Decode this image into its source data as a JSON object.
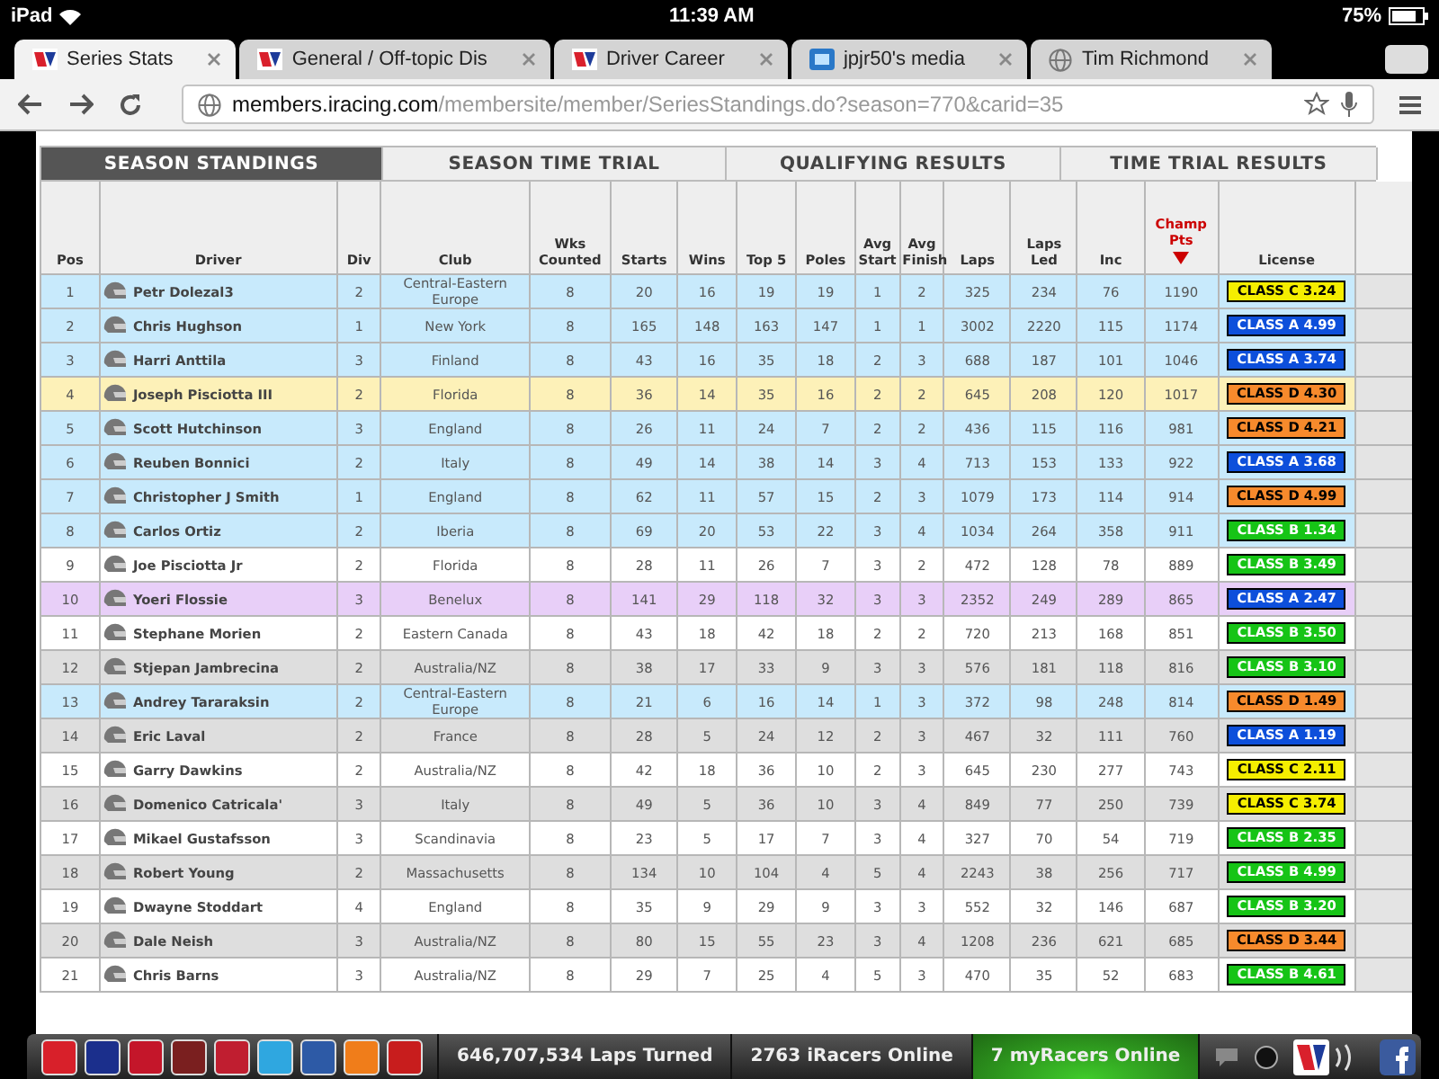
{
  "status_bar": {
    "device": "iPad",
    "time": "11:39 AM",
    "battery": "75%"
  },
  "browser_tabs": [
    {
      "title": "Series Stats",
      "selected": true
    },
    {
      "title": "General / Off-topic Dis",
      "selected": false
    },
    {
      "title": "Driver Career",
      "selected": false
    },
    {
      "title": "jpjr50's media",
      "selected": false
    },
    {
      "title": "Tim Richmond",
      "selected": false
    }
  ],
  "address_bar": {
    "host": "members.iracing.com",
    "path": "/membersite/member/SeriesStandings.do?season=770&carid=35"
  },
  "standings_tabs": [
    {
      "label": "SEASON STANDINGS",
      "selected": true
    },
    {
      "label": "SEASON TIME TRIAL",
      "selected": false
    },
    {
      "label": "QUALIFYING RESULTS",
      "selected": false
    },
    {
      "label": "TIME TRIAL RESULTS",
      "selected": false
    }
  ],
  "table": {
    "columns": [
      {
        "label": "Pos",
        "sorted": false
      },
      {
        "label": "Driver",
        "sorted": false
      },
      {
        "label": "Div",
        "sorted": false
      },
      {
        "label": "Club",
        "sorted": false
      },
      {
        "label": "Wks Counted",
        "sorted": false
      },
      {
        "label": "Starts",
        "sorted": false
      },
      {
        "label": "Wins",
        "sorted": false
      },
      {
        "label": "Top 5",
        "sorted": false
      },
      {
        "label": "Poles",
        "sorted": false
      },
      {
        "label": "Avg Start",
        "sorted": false
      },
      {
        "label": "Avg Finish",
        "sorted": false
      },
      {
        "label": "Laps",
        "sorted": false
      },
      {
        "label": "Laps Led",
        "sorted": false
      },
      {
        "label": "Inc",
        "sorted": false
      },
      {
        "label": "Champ Pts",
        "sorted": true
      },
      {
        "label": "License",
        "sorted": false
      }
    ],
    "rows": [
      {
        "cells": [
          "1",
          "Petr Dolezal3",
          "2",
          "Central-Eastern Europe",
          "8",
          "20",
          "16",
          "19",
          "19",
          "1",
          "2",
          "325",
          "234",
          "76",
          "1190"
        ],
        "license": {
          "text": "CLASS C 3.24",
          "color": "#f5ee00"
        },
        "color": "#c8eafc"
      },
      {
        "cells": [
          "2",
          "Chris Hughson",
          "1",
          "New York",
          "8",
          "165",
          "148",
          "163",
          "147",
          "1",
          "1",
          "3002",
          "2220",
          "115",
          "1174"
        ],
        "license": {
          "text": "CLASS A 4.99",
          "color": "#0d4fdb"
        },
        "color": "#c8eafc"
      },
      {
        "cells": [
          "3",
          "Harri Anttila",
          "3",
          "Finland",
          "8",
          "43",
          "16",
          "35",
          "18",
          "2",
          "3",
          "688",
          "187",
          "101",
          "1046"
        ],
        "license": {
          "text": "CLASS A 3.74",
          "color": "#0d4fdb"
        },
        "color": "#c8eafc"
      },
      {
        "cells": [
          "4",
          "Joseph Pisciotta III",
          "2",
          "Florida",
          "8",
          "36",
          "14",
          "35",
          "16",
          "2",
          "2",
          "645",
          "208",
          "120",
          "1017"
        ],
        "license": {
          "text": "CLASS D 4.30",
          "color": "#f78a2c"
        },
        "color": "#fdf1b8"
      },
      {
        "cells": [
          "5",
          "Scott Hutchinson",
          "3",
          "England",
          "8",
          "26",
          "11",
          "24",
          "7",
          "2",
          "2",
          "436",
          "115",
          "116",
          "981"
        ],
        "license": {
          "text": "CLASS D 4.21",
          "color": "#f78a2c"
        },
        "color": "#c8eafc"
      },
      {
        "cells": [
          "6",
          "Reuben Bonnici",
          "2",
          "Italy",
          "8",
          "49",
          "14",
          "38",
          "14",
          "3",
          "4",
          "713",
          "153",
          "133",
          "922"
        ],
        "license": {
          "text": "CLASS A 3.68",
          "color": "#0d4fdb"
        },
        "color": "#c8eafc"
      },
      {
        "cells": [
          "7",
          "Christopher J Smith",
          "1",
          "England",
          "8",
          "62",
          "11",
          "57",
          "15",
          "2",
          "3",
          "1079",
          "173",
          "114",
          "914"
        ],
        "license": {
          "text": "CLASS D 4.99",
          "color": "#f78a2c"
        },
        "color": "#c8eafc"
      },
      {
        "cells": [
          "8",
          "Carlos Ortiz",
          "2",
          "Iberia",
          "8",
          "69",
          "20",
          "53",
          "22",
          "3",
          "4",
          "1034",
          "264",
          "358",
          "911"
        ],
        "license": {
          "text": "CLASS B 1.34",
          "color": "#16c416"
        },
        "color": "#c8eafc"
      },
      {
        "cells": [
          "9",
          "Joe Pisciotta Jr",
          "2",
          "Florida",
          "8",
          "28",
          "11",
          "26",
          "7",
          "3",
          "2",
          "472",
          "128",
          "78",
          "889"
        ],
        "license": {
          "text": "CLASS B 3.49",
          "color": "#16c416"
        },
        "color": "#ffffff"
      },
      {
        "cells": [
          "10",
          "Yoeri Flossie",
          "3",
          "Benelux",
          "8",
          "141",
          "29",
          "118",
          "32",
          "3",
          "3",
          "2352",
          "249",
          "289",
          "865"
        ],
        "license": {
          "text": "CLASS A 2.47",
          "color": "#0d4fdb"
        },
        "color": "#e8cff8"
      },
      {
        "cells": [
          "11",
          "Stephane Morien",
          "2",
          "Eastern Canada",
          "8",
          "43",
          "18",
          "42",
          "18",
          "2",
          "2",
          "720",
          "213",
          "168",
          "851"
        ],
        "license": {
          "text": "CLASS B 3.50",
          "color": "#16c416"
        },
        "color": "#ffffff"
      },
      {
        "cells": [
          "12",
          "Stjepan Jambrecina",
          "2",
          "Australia/NZ",
          "8",
          "38",
          "17",
          "33",
          "9",
          "3",
          "3",
          "576",
          "181",
          "118",
          "816"
        ],
        "license": {
          "text": "CLASS B 3.10",
          "color": "#16c416"
        },
        "color": "#dedede"
      },
      {
        "cells": [
          "13",
          "Andrey Tararaksin",
          "2",
          "Central-Eastern Europe",
          "8",
          "21",
          "6",
          "16",
          "14",
          "1",
          "3",
          "372",
          "98",
          "248",
          "814"
        ],
        "license": {
          "text": "CLASS D 1.49",
          "color": "#f78a2c"
        },
        "color": "#c8eafc"
      },
      {
        "cells": [
          "14",
          "Eric Laval",
          "2",
          "France",
          "8",
          "28",
          "5",
          "24",
          "12",
          "2",
          "3",
          "467",
          "32",
          "111",
          "760"
        ],
        "license": {
          "text": "CLASS A 1.19",
          "color": "#0d4fdb"
        },
        "color": "#dedede"
      },
      {
        "cells": [
          "15",
          "Garry Dawkins",
          "2",
          "Australia/NZ",
          "8",
          "42",
          "18",
          "36",
          "10",
          "2",
          "3",
          "645",
          "230",
          "277",
          "743"
        ],
        "license": {
          "text": "CLASS C 2.11",
          "color": "#f5ee00"
        },
        "color": "#ffffff"
      },
      {
        "cells": [
          "16",
          "Domenico Catricala'",
          "3",
          "Italy",
          "8",
          "49",
          "5",
          "36",
          "10",
          "3",
          "4",
          "849",
          "77",
          "250",
          "739"
        ],
        "license": {
          "text": "CLASS C 3.74",
          "color": "#f5ee00"
        },
        "color": "#dedede"
      },
      {
        "cells": [
          "17",
          "Mikael Gustafsson",
          "3",
          "Scandinavia",
          "8",
          "23",
          "5",
          "17",
          "7",
          "3",
          "4",
          "327",
          "70",
          "54",
          "719"
        ],
        "license": {
          "text": "CLASS B 2.35",
          "color": "#16c416"
        },
        "color": "#ffffff"
      },
      {
        "cells": [
          "18",
          "Robert Young",
          "2",
          "Massachusetts",
          "8",
          "134",
          "10",
          "104",
          "4",
          "5",
          "4",
          "2243",
          "38",
          "256",
          "717"
        ],
        "license": {
          "text": "CLASS B 4.99",
          "color": "#16c416"
        },
        "color": "#dedede"
      },
      {
        "cells": [
          "19",
          "Dwayne Stoddart",
          "4",
          "England",
          "8",
          "35",
          "9",
          "29",
          "9",
          "3",
          "3",
          "552",
          "32",
          "146",
          "687"
        ],
        "license": {
          "text": "CLASS B 3.20",
          "color": "#16c416"
        },
        "color": "#ffffff"
      },
      {
        "cells": [
          "20",
          "Dale Neish",
          "3",
          "Australia/NZ",
          "8",
          "80",
          "15",
          "55",
          "23",
          "3",
          "4",
          "1208",
          "236",
          "621",
          "685"
        ],
        "license": {
          "text": "CLASS D 3.44",
          "color": "#f78a2c"
        },
        "color": "#dedede"
      },
      {
        "cells": [
          "21",
          "Chris Barns",
          "3",
          "Australia/NZ",
          "8",
          "29",
          "7",
          "25",
          "4",
          "5",
          "3",
          "470",
          "35",
          "52",
          "683"
        ],
        "license": {
          "text": "CLASS B 4.61",
          "color": "#16c416"
        },
        "color": "#ffffff"
      }
    ]
  },
  "bottom_bar": {
    "apps": [
      {
        "color": "#d8202a"
      },
      {
        "color": "#1b2f8c"
      },
      {
        "color": "#c4162a"
      },
      {
        "color": "#7a1f1f"
      },
      {
        "color": "#c01e30"
      },
      {
        "color": "#2fa7e0"
      },
      {
        "color": "#2d5aa6"
      },
      {
        "color": "#f07d1a"
      },
      {
        "color": "#c81d1d"
      }
    ],
    "stats": [
      {
        "text": "646,707,534 Laps Turned",
        "highlighted": false
      },
      {
        "text": "2763 iRacers Online",
        "highlighted": false
      },
      {
        "text": "7 myRacers Online",
        "highlighted": true
      }
    ]
  }
}
